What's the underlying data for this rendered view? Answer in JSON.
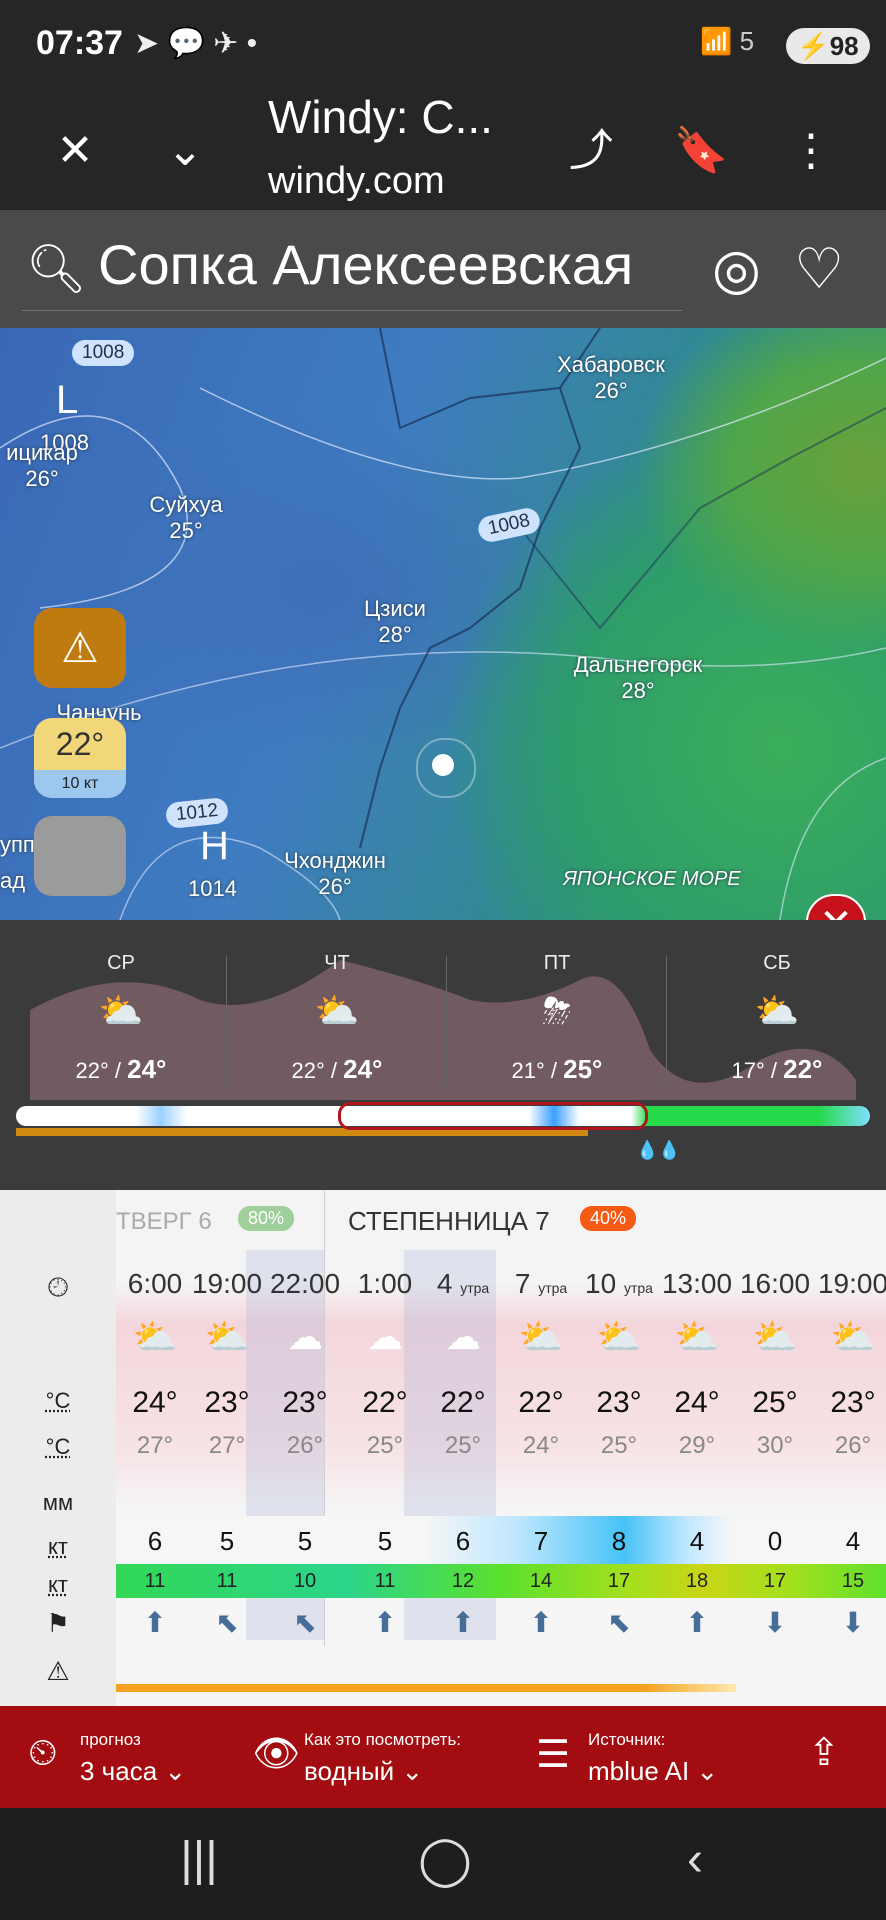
{
  "status_bar": {
    "time": "07:37",
    "notification_icons": "➤ 💬 ✈ •",
    "signal": "5",
    "battery": "98"
  },
  "browser": {
    "title": "Windy: С...",
    "url": "windy.com"
  },
  "search": {
    "location": "Сопка Алексеевская"
  },
  "map": {
    "labels": [
      {
        "name": "Хабаровск",
        "temp": "26°"
      },
      {
        "name": "ицикар",
        "temp": "26°"
      },
      {
        "name": "Суйхуа",
        "temp": "25°"
      },
      {
        "name": "Цзиси",
        "temp": "28°"
      },
      {
        "name": "Дальнегорск",
        "temp": "28°"
      },
      {
        "name": "Чанчунь",
        "temp": ""
      },
      {
        "name": "Чхонджин",
        "temp": "26°"
      },
      {
        "name": "упп",
        "temp": ""
      },
      {
        "name": "ад",
        "temp": ""
      }
    ],
    "sea_label": "ЯПОНСКОЕ МОРЕ",
    "isobars": [
      "1008",
      "1008",
      "1012"
    ],
    "pressure_low": {
      "letter": "L",
      "value": "1008"
    },
    "pressure_high": {
      "letter": "H",
      "value": "1014"
    },
    "current_temp": "22°",
    "current_wind": "10 кт"
  },
  "overview": {
    "days": [
      {
        "name": "СР",
        "icon": "⛅",
        "low": "22°",
        "high": "24°"
      },
      {
        "name": "ЧТ",
        "icon": "⛅",
        "low": "22°",
        "high": "24°"
      },
      {
        "name": "ПТ",
        "icon": "⛈",
        "low": "21°",
        "high": "25°"
      },
      {
        "name": "СБ",
        "icon": "⛅",
        "low": "17°",
        "high": "22°"
      }
    ],
    "rain_drops": "💧💧"
  },
  "detail": {
    "day1": {
      "name": "ТВЕРГ 6",
      "prob": "80%"
    },
    "day2": {
      "name": "СТЕПЕННИЦА 7",
      "prob": "40%"
    },
    "units": {
      "temp": "°C",
      "feels": "°C",
      "rain": "мм",
      "wind": "кт",
      "gust": "кт"
    },
    "hours": [
      {
        "h": "6:00",
        "s": "",
        "icon": "⛅",
        "t": "24°",
        "f": "27°",
        "w": "6",
        "g": "11",
        "d": "⬆"
      },
      {
        "h": "19:00",
        "s": "",
        "icon": "⛅",
        "t": "23°",
        "f": "27°",
        "w": "5",
        "g": "11",
        "d": "⬉"
      },
      {
        "h": "22:00",
        "s": "",
        "icon": "☁",
        "t": "23°",
        "f": "26°",
        "w": "5",
        "g": "10",
        "d": "⬉"
      },
      {
        "h": "1:00",
        "s": "",
        "icon": "☁",
        "t": "22°",
        "f": "25°",
        "w": "5",
        "g": "11",
        "d": "⬆"
      },
      {
        "h": "4",
        "s": "утра",
        "icon": "☁",
        "t": "22°",
        "f": "25°",
        "w": "6",
        "g": "12",
        "d": "⬆"
      },
      {
        "h": "7",
        "s": "утра",
        "icon": "⛅",
        "t": "22°",
        "f": "24°",
        "w": "7",
        "g": "14",
        "d": "⬆"
      },
      {
        "h": "10",
        "s": "утра",
        "icon": "⛅",
        "t": "23°",
        "f": "25°",
        "w": "8",
        "g": "17",
        "d": "⬉"
      },
      {
        "h": "13:00",
        "s": "",
        "icon": "⛅",
        "t": "24°",
        "f": "29°",
        "w": "4",
        "g": "18",
        "d": "⬆"
      },
      {
        "h": "16:00",
        "s": "",
        "icon": "⛅",
        "t": "25°",
        "f": "30°",
        "w": "0",
        "g": "17",
        "d": "⬇"
      },
      {
        "h": "19:00",
        "s": "",
        "icon": "⛅",
        "t": "23°",
        "f": "26°",
        "w": "4",
        "g": "15",
        "d": "⬇"
      }
    ]
  },
  "bottom_bar": {
    "forecast_label": "прогноз",
    "forecast_value": "3 часа",
    "view_label": "Как это посмотреть:",
    "view_value": "водный",
    "source_label": "Источник:",
    "source_value": "mblue AI"
  }
}
